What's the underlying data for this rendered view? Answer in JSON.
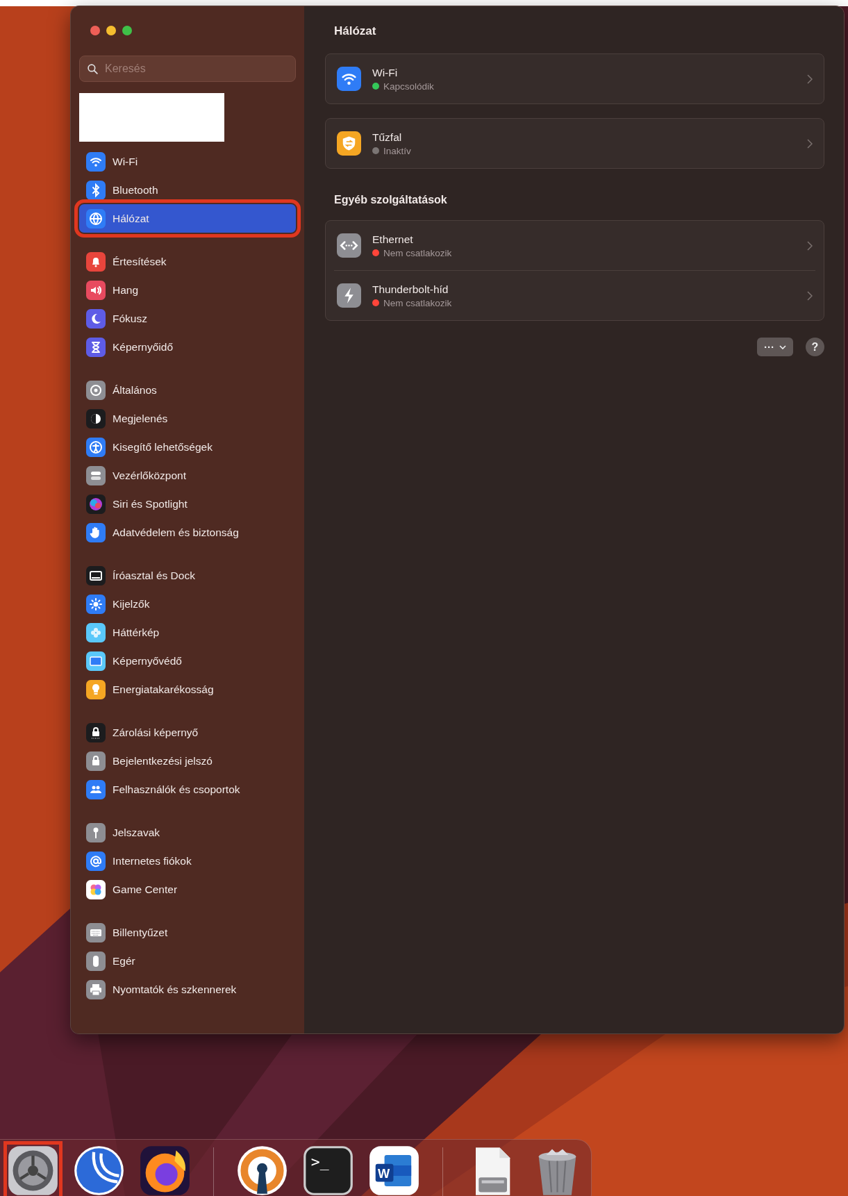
{
  "window": {
    "title": "Hálózat"
  },
  "sidebar": {
    "search": {
      "placeholder": "Keresés"
    },
    "groups": [
      [
        {
          "label": "Wi-Fi",
          "selected": false,
          "marked": false
        },
        {
          "label": "Bluetooth",
          "selected": false,
          "marked": false
        },
        {
          "label": "Hálózat",
          "selected": true,
          "marked": true
        }
      ],
      [
        {
          "label": "Értesítések",
          "selected": false,
          "marked": false
        },
        {
          "label": "Hang",
          "selected": false,
          "marked": false
        },
        {
          "label": "Fókusz",
          "selected": false,
          "marked": false
        },
        {
          "label": "Képernyőidő",
          "selected": false,
          "marked": false
        }
      ],
      [
        {
          "label": "Általános",
          "selected": false,
          "marked": false
        },
        {
          "label": "Megjelenés",
          "selected": false,
          "marked": false
        },
        {
          "label": "Kisegítő lehetőségek",
          "selected": false,
          "marked": false
        },
        {
          "label": "Vezérlőközpont",
          "selected": false,
          "marked": false
        },
        {
          "label": "Siri és Spotlight",
          "selected": false,
          "marked": false
        },
        {
          "label": "Adatvédelem és biztonság",
          "selected": false,
          "marked": false
        }
      ],
      [
        {
          "label": "Íróasztal és Dock",
          "selected": false,
          "marked": false
        },
        {
          "label": "Kijelzők",
          "selected": false,
          "marked": false
        },
        {
          "label": "Háttérkép",
          "selected": false,
          "marked": false
        },
        {
          "label": "Képernyővédő",
          "selected": false,
          "marked": false
        },
        {
          "label": "Energiatakarékosság",
          "selected": false,
          "marked": false
        }
      ],
      [
        {
          "label": "Zárolási képernyő",
          "selected": false,
          "marked": false
        },
        {
          "label": "Bejelentkezési jelszó",
          "selected": false,
          "marked": false
        },
        {
          "label": "Felhasználók és csoportok",
          "selected": false,
          "marked": false
        }
      ],
      [
        {
          "label": "Jelszavak",
          "selected": false,
          "marked": false
        },
        {
          "label": "Internetes fiókok",
          "selected": false,
          "marked": false
        },
        {
          "label": "Game Center",
          "selected": false,
          "marked": false
        }
      ],
      [
        {
          "label": "Billentyűzet",
          "selected": false,
          "marked": false
        },
        {
          "label": "Egér",
          "selected": false,
          "marked": false
        },
        {
          "label": "Nyomtatók és szkennerek",
          "selected": false,
          "marked": false
        }
      ]
    ]
  },
  "sections": [
    {
      "cards": [
        {
          "kind": "wifi",
          "name": "Wi-Fi",
          "status": "Kapcsolódik",
          "color": "#34c759"
        }
      ]
    },
    {
      "cards": [
        {
          "kind": "firewall",
          "name": "Tűzfal",
          "status": "Inaktív",
          "color": "#7b7574"
        }
      ]
    },
    {
      "heading": "Egyéb szolgáltatások",
      "cards": [
        {
          "kind": "ethernet",
          "name": "Ethernet",
          "status": "Nem csatlakozik",
          "color": "#ff453a"
        },
        {
          "kind": "thunderbolt",
          "name": "Thunderbolt-híd",
          "status": "Nem csatlakozik",
          "color": "#ff453a"
        }
      ]
    }
  ],
  "actions": {
    "more": "···",
    "help": "?"
  },
  "dock": [
    {
      "kind": "settings",
      "marked": true
    },
    {
      "kind": "arcs",
      "marked": false
    },
    {
      "kind": "fox",
      "marked": false
    },
    {
      "kind": "separator"
    },
    {
      "kind": "vpn",
      "marked": false
    },
    {
      "kind": "terminal",
      "marked": false,
      "glyph": ">_"
    },
    {
      "kind": "word",
      "marked": false,
      "glyph": "W"
    },
    {
      "kind": "separator"
    },
    {
      "kind": "drive",
      "marked": false
    },
    {
      "kind": "trash",
      "marked": false
    }
  ]
}
